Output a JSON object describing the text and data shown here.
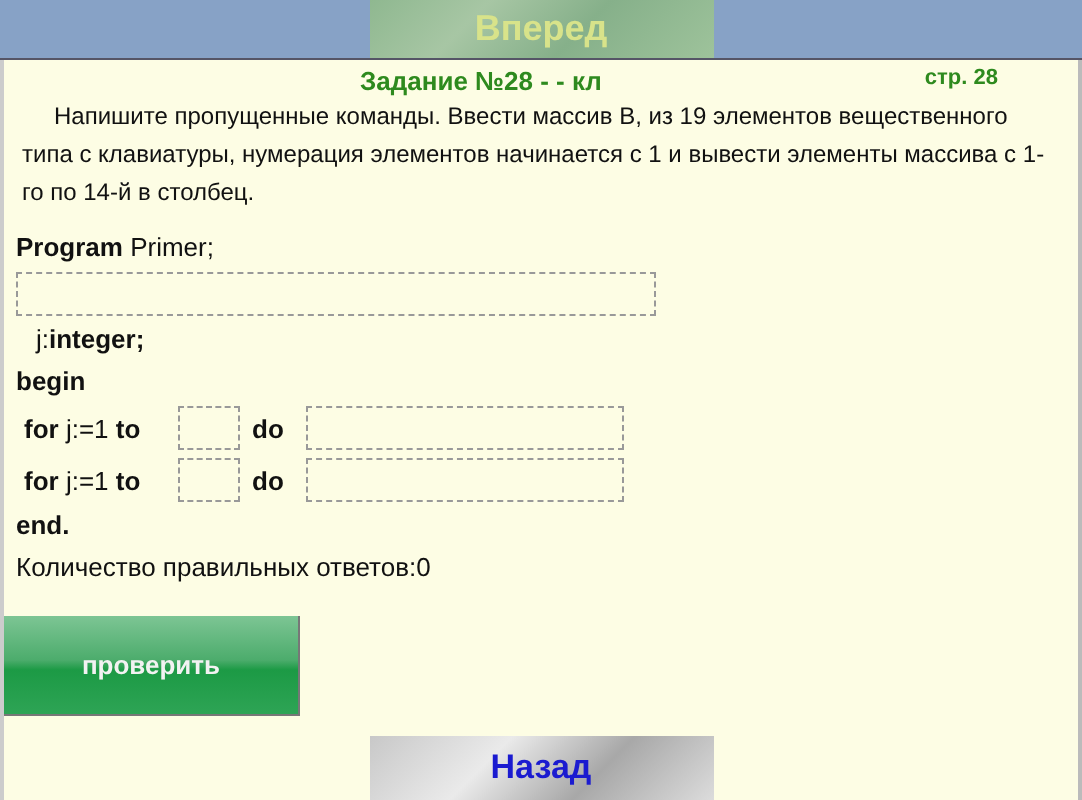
{
  "forward_button": {
    "label": "Вперед"
  },
  "task": {
    "title": "Задание №28 -  -  кл",
    "page": "стр. 28",
    "text": "Напишите пропущенные команды. Ввести массив B, из 19 элементов  вещественного типа с клавиатуры, нумерация элементов начинается с 1 и вывести элементы массива с 1-го по 14-й  в столбец."
  },
  "code": [
    {
      "kind": "line",
      "text": "**Program** Primer;"
    },
    {
      "kind": "field"
    },
    {
      "kind": "indent",
      "text": "j:**integer;**"
    },
    {
      "kind": "keyword",
      "text": "begin"
    },
    {
      "kind": "loop",
      "head": "**for** j:=1 **to**",
      "mid": "do"
    },
    {
      "kind": "loop",
      "head": "**for** j:=1 **to**",
      "mid": "do"
    },
    {
      "kind": "keyword",
      "text": "end."
    }
  ],
  "result": "Количество правильных ответов:0",
  "check_button": {
    "label": "проверить"
  },
  "back_button": {
    "label": "Назад"
  }
}
